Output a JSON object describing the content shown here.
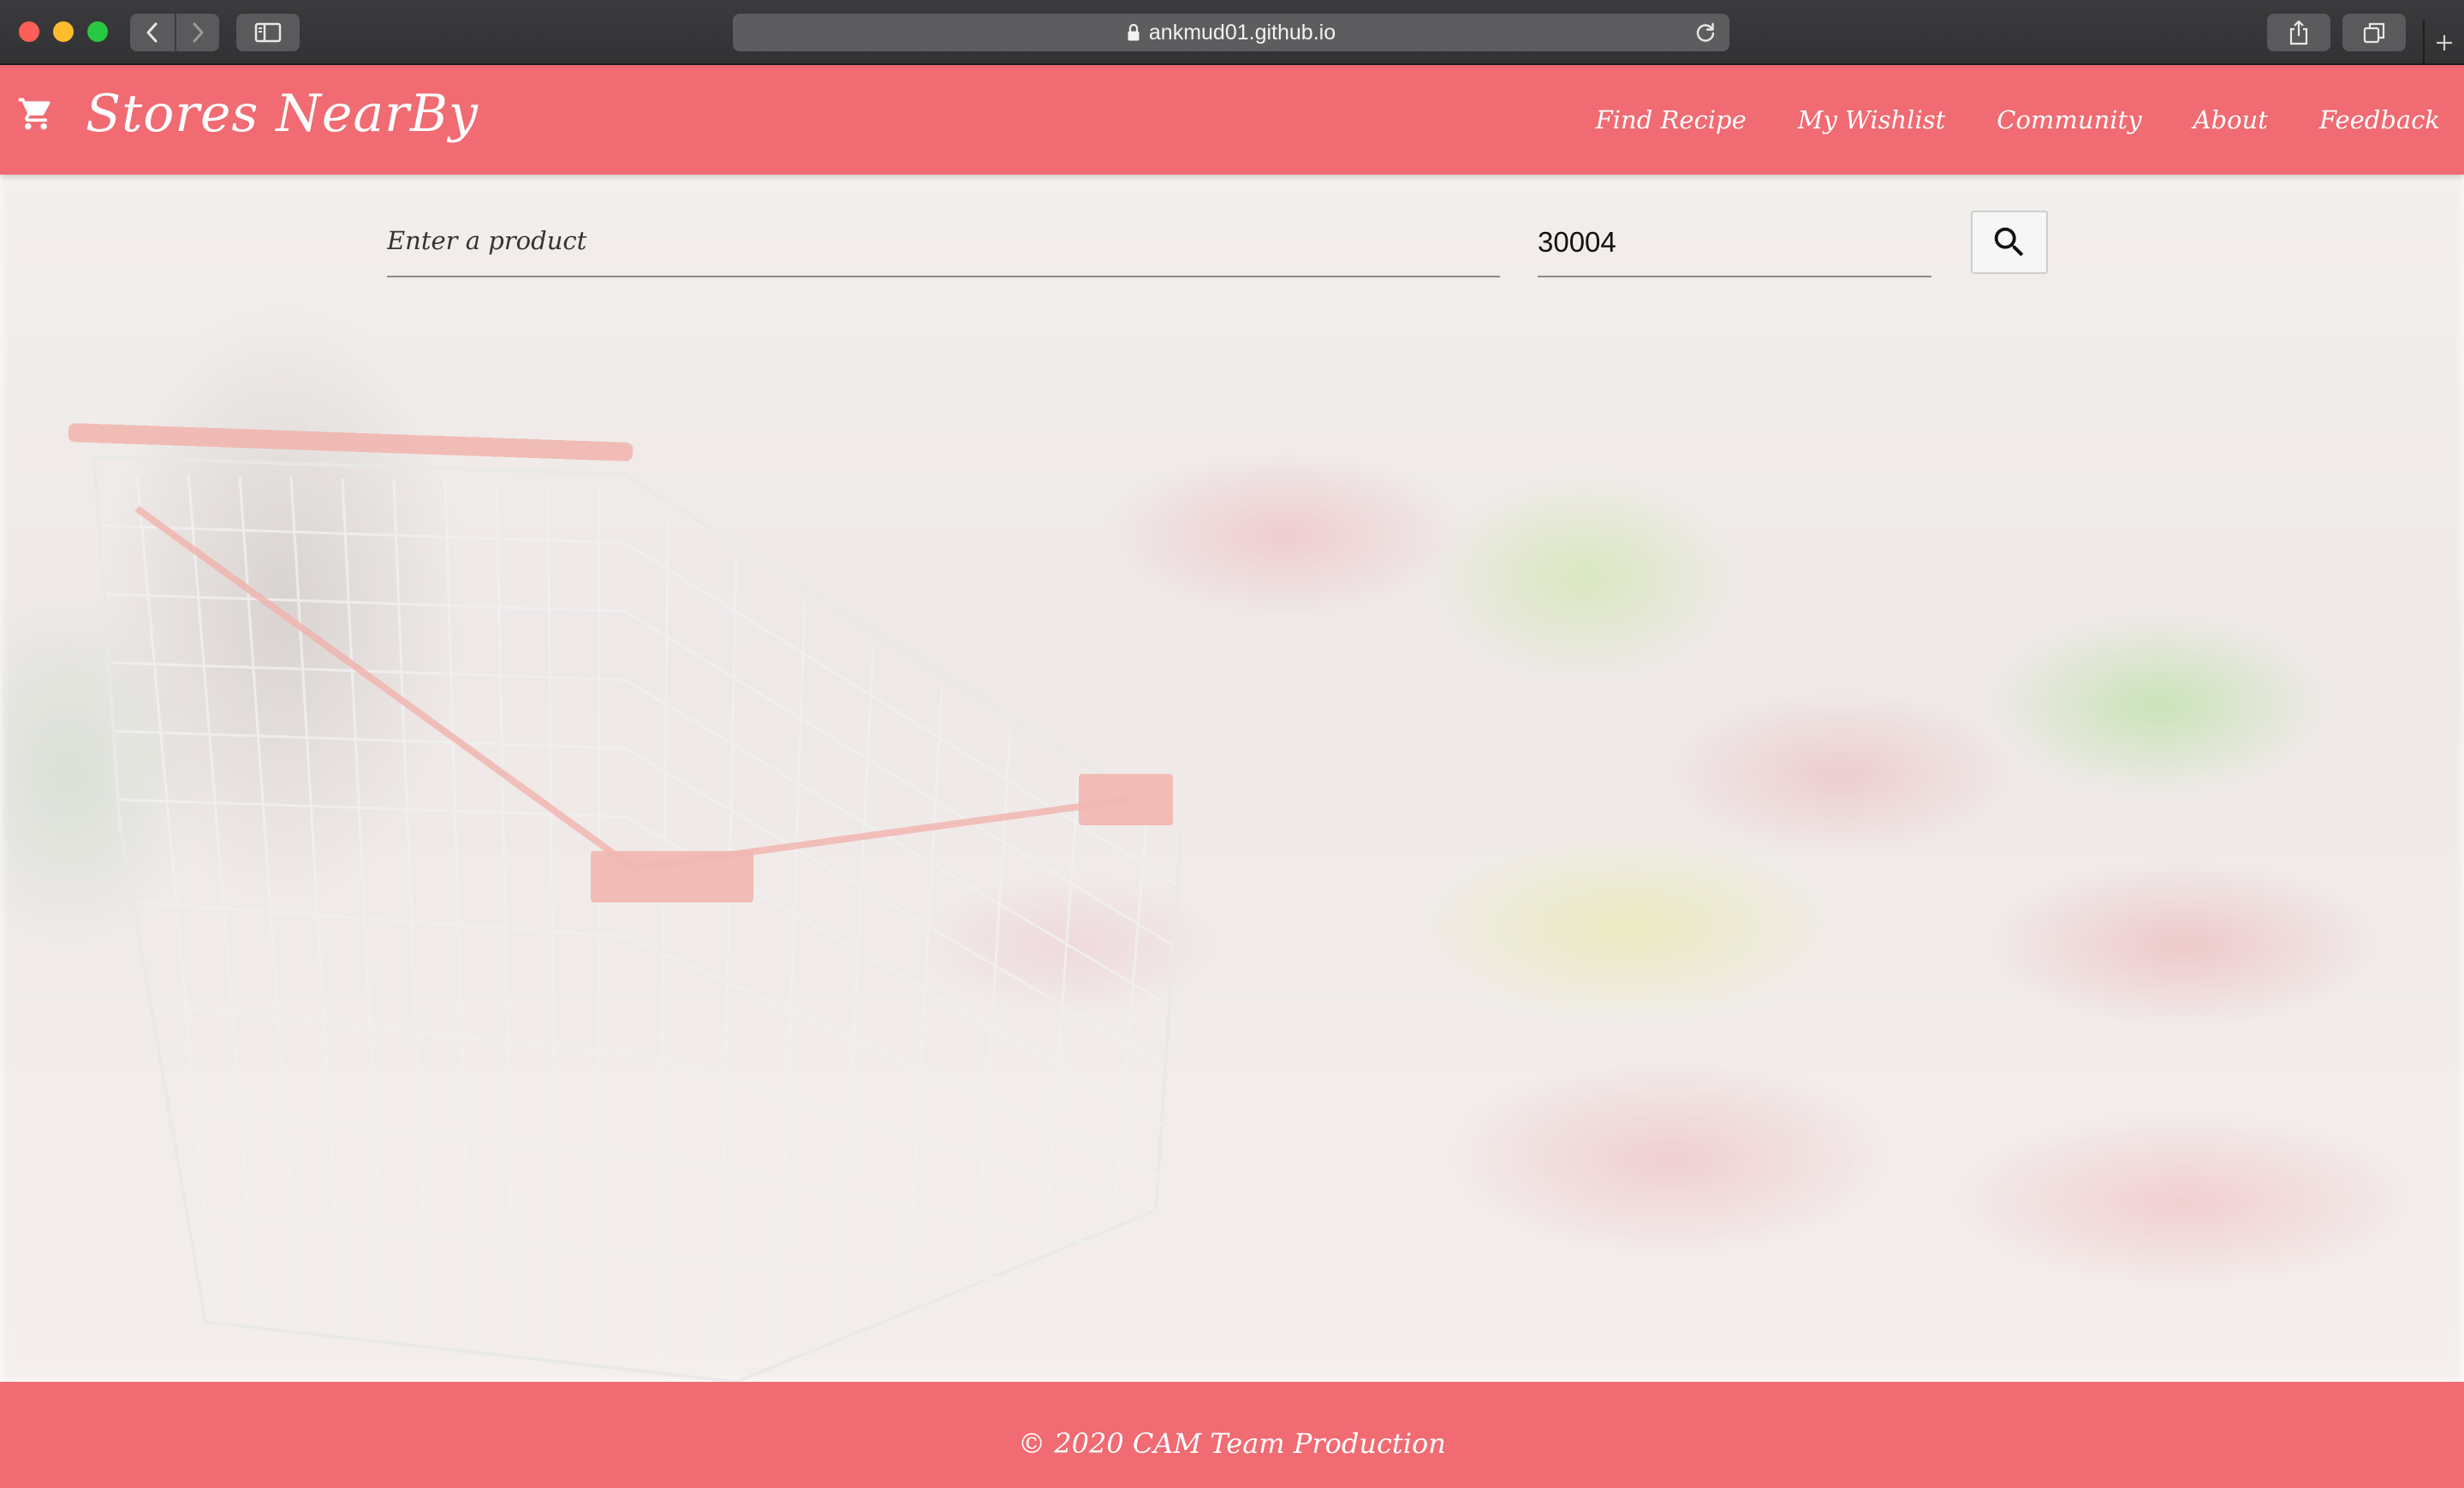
{
  "browser": {
    "url": "ankmud01.github.io",
    "icons": {
      "back": "chevron-left-icon",
      "forward": "chevron-right-icon",
      "sidebar": "sidebar-icon",
      "lock": "lock-icon",
      "reload": "reload-icon",
      "share": "share-icon",
      "tabs": "tabs-overview-icon",
      "new_tab": "plus-icon"
    },
    "traffic_colors": [
      "#fe5f57",
      "#febc2e",
      "#28c840"
    ]
  },
  "header": {
    "brand_icon": "shopping-cart-icon",
    "title": "Stores NearBy",
    "background": "#f06b72",
    "nav": [
      {
        "label": "Find Recipe"
      },
      {
        "label": "My Wishlist"
      },
      {
        "label": "Community"
      },
      {
        "label": "About"
      },
      {
        "label": "Feedback"
      }
    ]
  },
  "search": {
    "product_placeholder": "Enter a product",
    "product_value": "",
    "zip_value": "30004",
    "button_icon": "search-icon"
  },
  "hero": {
    "background_image": "blurred supermarket aisle with shopping cart"
  },
  "footer": {
    "text": "© 2020 CAM Team Production",
    "background": "#f06b72"
  }
}
